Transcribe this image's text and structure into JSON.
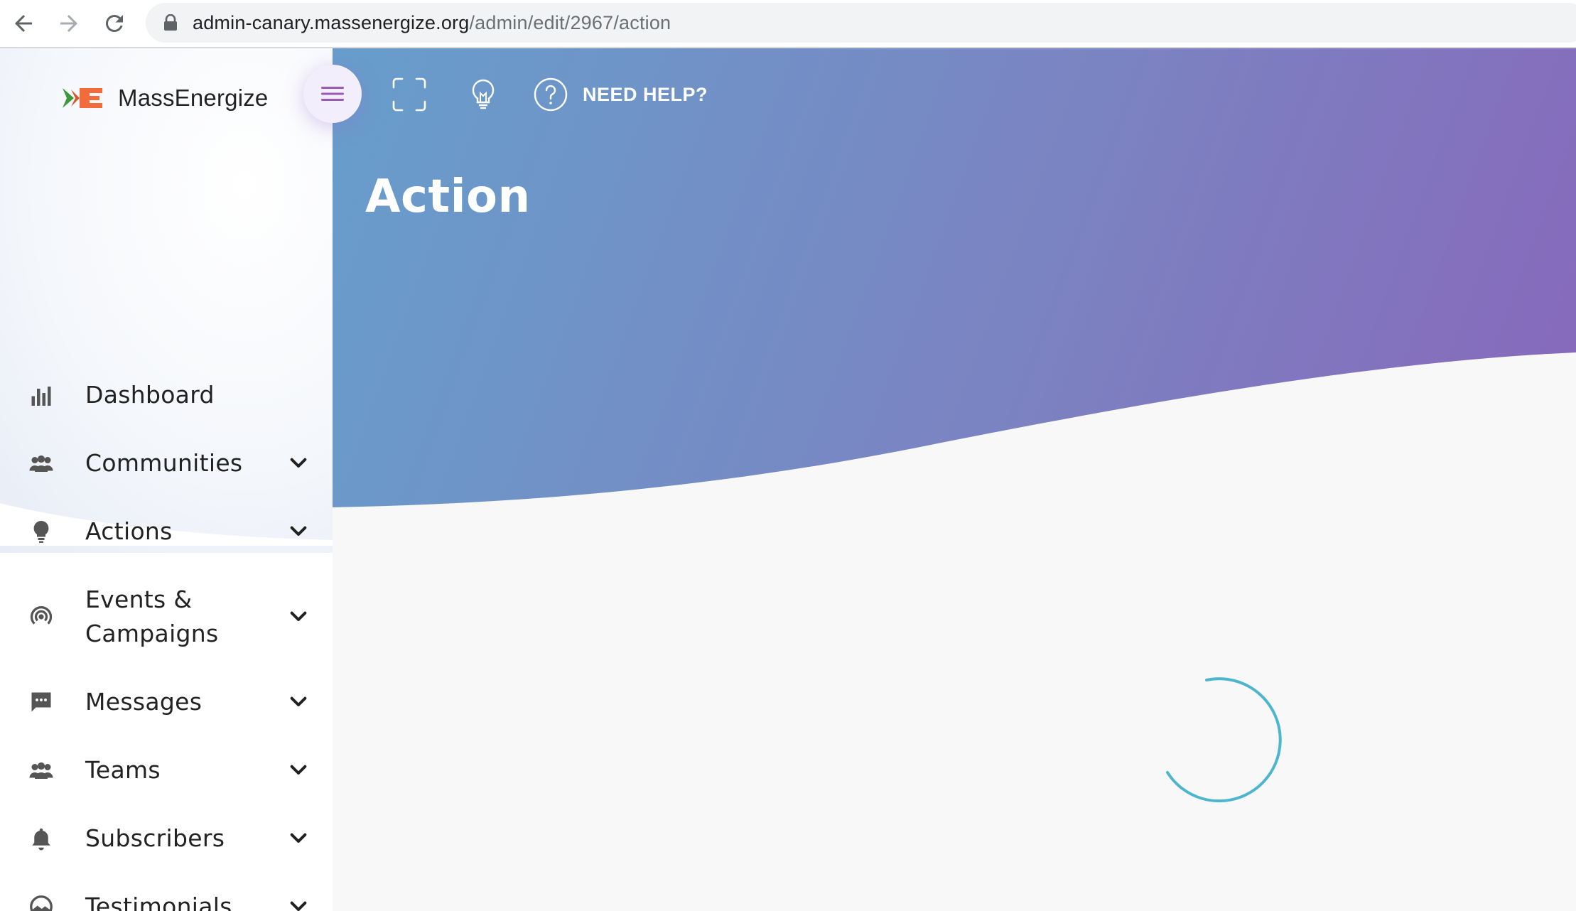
{
  "browser": {
    "url_host": "admin-canary.massenergize.org",
    "url_path": "/admin/edit/2967/action",
    "icons": [
      "back-arrow-icon",
      "forward-arrow-icon",
      "reload-icon",
      "lock-icon"
    ]
  },
  "brand": {
    "name": "MassEnergize",
    "logo_icon": "massenergize-logo-icon"
  },
  "toolbar": {
    "menu_icon": "hamburger-menu-icon",
    "fullscreen_icon": "fullscreen-icon",
    "theme_icon": "lightbulb-icon",
    "help_icon": "question-circle-icon",
    "help_label": "NEED HELP?"
  },
  "page": {
    "title": "Action",
    "loading": true
  },
  "sidebar": {
    "items": [
      {
        "label": "Dashboard",
        "icon": "bar-chart-icon",
        "has_submenu": false
      },
      {
        "label": "Communities",
        "icon": "people-icon",
        "has_submenu": true
      },
      {
        "label": "Actions",
        "icon": "lightbulb-icon",
        "has_submenu": true
      },
      {
        "label_line1": "Events &",
        "label_line2": "Campaigns",
        "icon": "broadcast-icon",
        "has_submenu": true
      },
      {
        "label": "Messages",
        "icon": "message-icon",
        "has_submenu": true
      },
      {
        "label": "Teams",
        "icon": "people-icon",
        "has_submenu": true
      },
      {
        "label": "Subscribers",
        "icon": "bell-icon",
        "has_submenu": true
      },
      {
        "label": "Testimonials",
        "icon": "landscape-icon",
        "has_submenu": true
      }
    ]
  },
  "colors": {
    "header_gradient_start": "#5fa6d0",
    "header_gradient_end": "#8867bb",
    "spinner": "#4db6cf",
    "menu_toggle_icon": "#9b59b6",
    "logo_orange": "#f26b3a",
    "logo_green": "#3a9a3a"
  }
}
